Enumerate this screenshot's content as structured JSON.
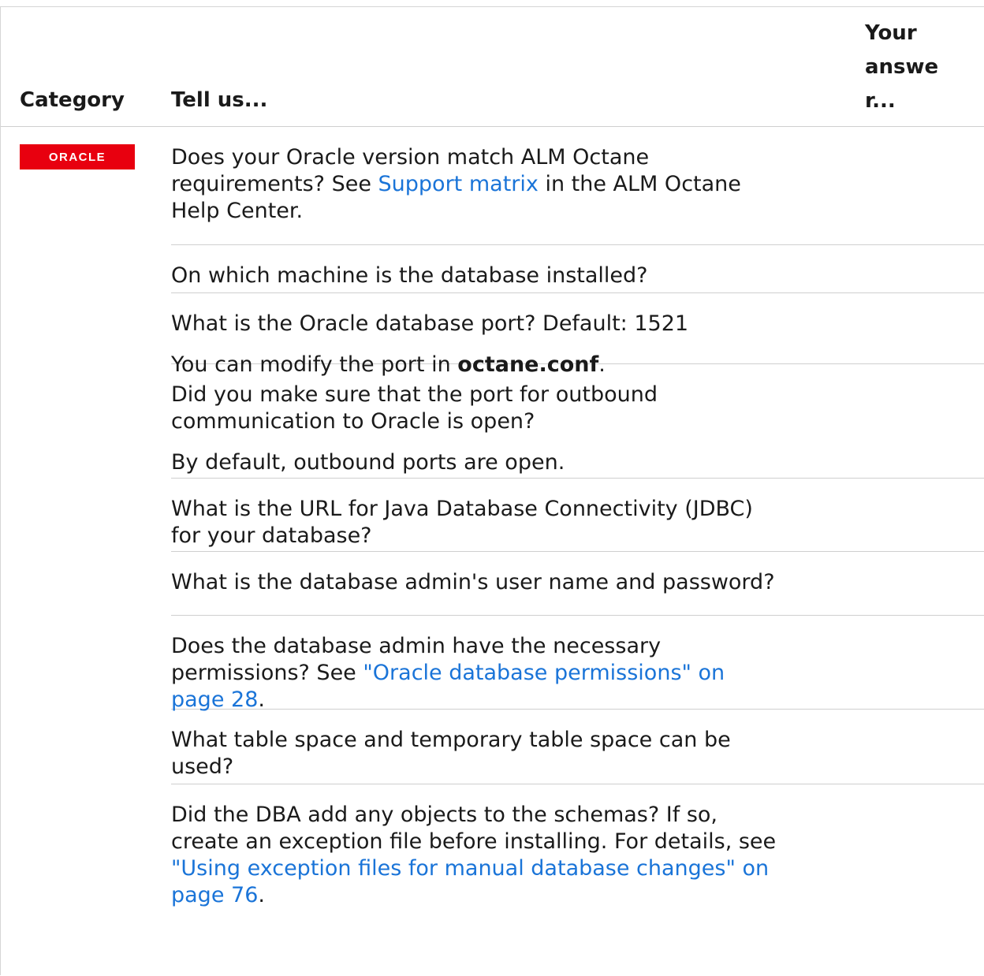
{
  "table": {
    "headers": {
      "category": "Category",
      "tell_us": "Tell us...",
      "your_answer_lines": [
        "Your",
        "answe",
        "r..."
      ]
    },
    "category_logo_text": "ORACLE",
    "rows": [
      {
        "lines": [
          [
            "Does your Oracle version match ALM Octane"
          ],
          [
            "requirements? See ",
            {
              "link": "Support matrix"
            },
            " in the ALM Octane"
          ],
          [
            "Help Center."
          ]
        ]
      },
      {
        "lines": [
          [
            "On which machine is the database installed?"
          ]
        ]
      },
      {
        "lines": [
          [
            "What is the Oracle database port? Default: 1521"
          ]
        ],
        "extra": [
          [
            "You can modify the port in ",
            {
              "bold": "octane.conf"
            },
            "."
          ]
        ]
      },
      {
        "lines": [
          [
            "Did you make sure that the port for outbound"
          ],
          [
            "communication to Oracle is open?"
          ]
        ],
        "extra": [
          [
            "By default, outbound ports are open."
          ]
        ]
      },
      {
        "lines": [
          [
            "What is the URL for Java Database Connectivity (JDBC)"
          ],
          [
            "for your database?"
          ]
        ]
      },
      {
        "lines": [
          [
            "What is the database admin's user name and password?"
          ]
        ]
      },
      {
        "lines": [
          [
            "Does the database admin have the necessary"
          ],
          [
            "permissions? See ",
            {
              "link": "\"Oracle database permissions\" on"
            }
          ],
          [
            {
              "link": "page 28"
            },
            "."
          ]
        ]
      },
      {
        "lines": [
          [
            "What table space and temporary table space can be"
          ],
          [
            "used?"
          ]
        ]
      },
      {
        "lines": [
          [
            "Did the DBA add any objects to the schemas? If so,"
          ],
          [
            "create an exception file before installing. For details, see"
          ],
          [
            {
              "link": "\"Using exception files for manual database changes\" on"
            }
          ],
          [
            {
              "link": "page 76"
            },
            "."
          ]
        ]
      }
    ]
  }
}
